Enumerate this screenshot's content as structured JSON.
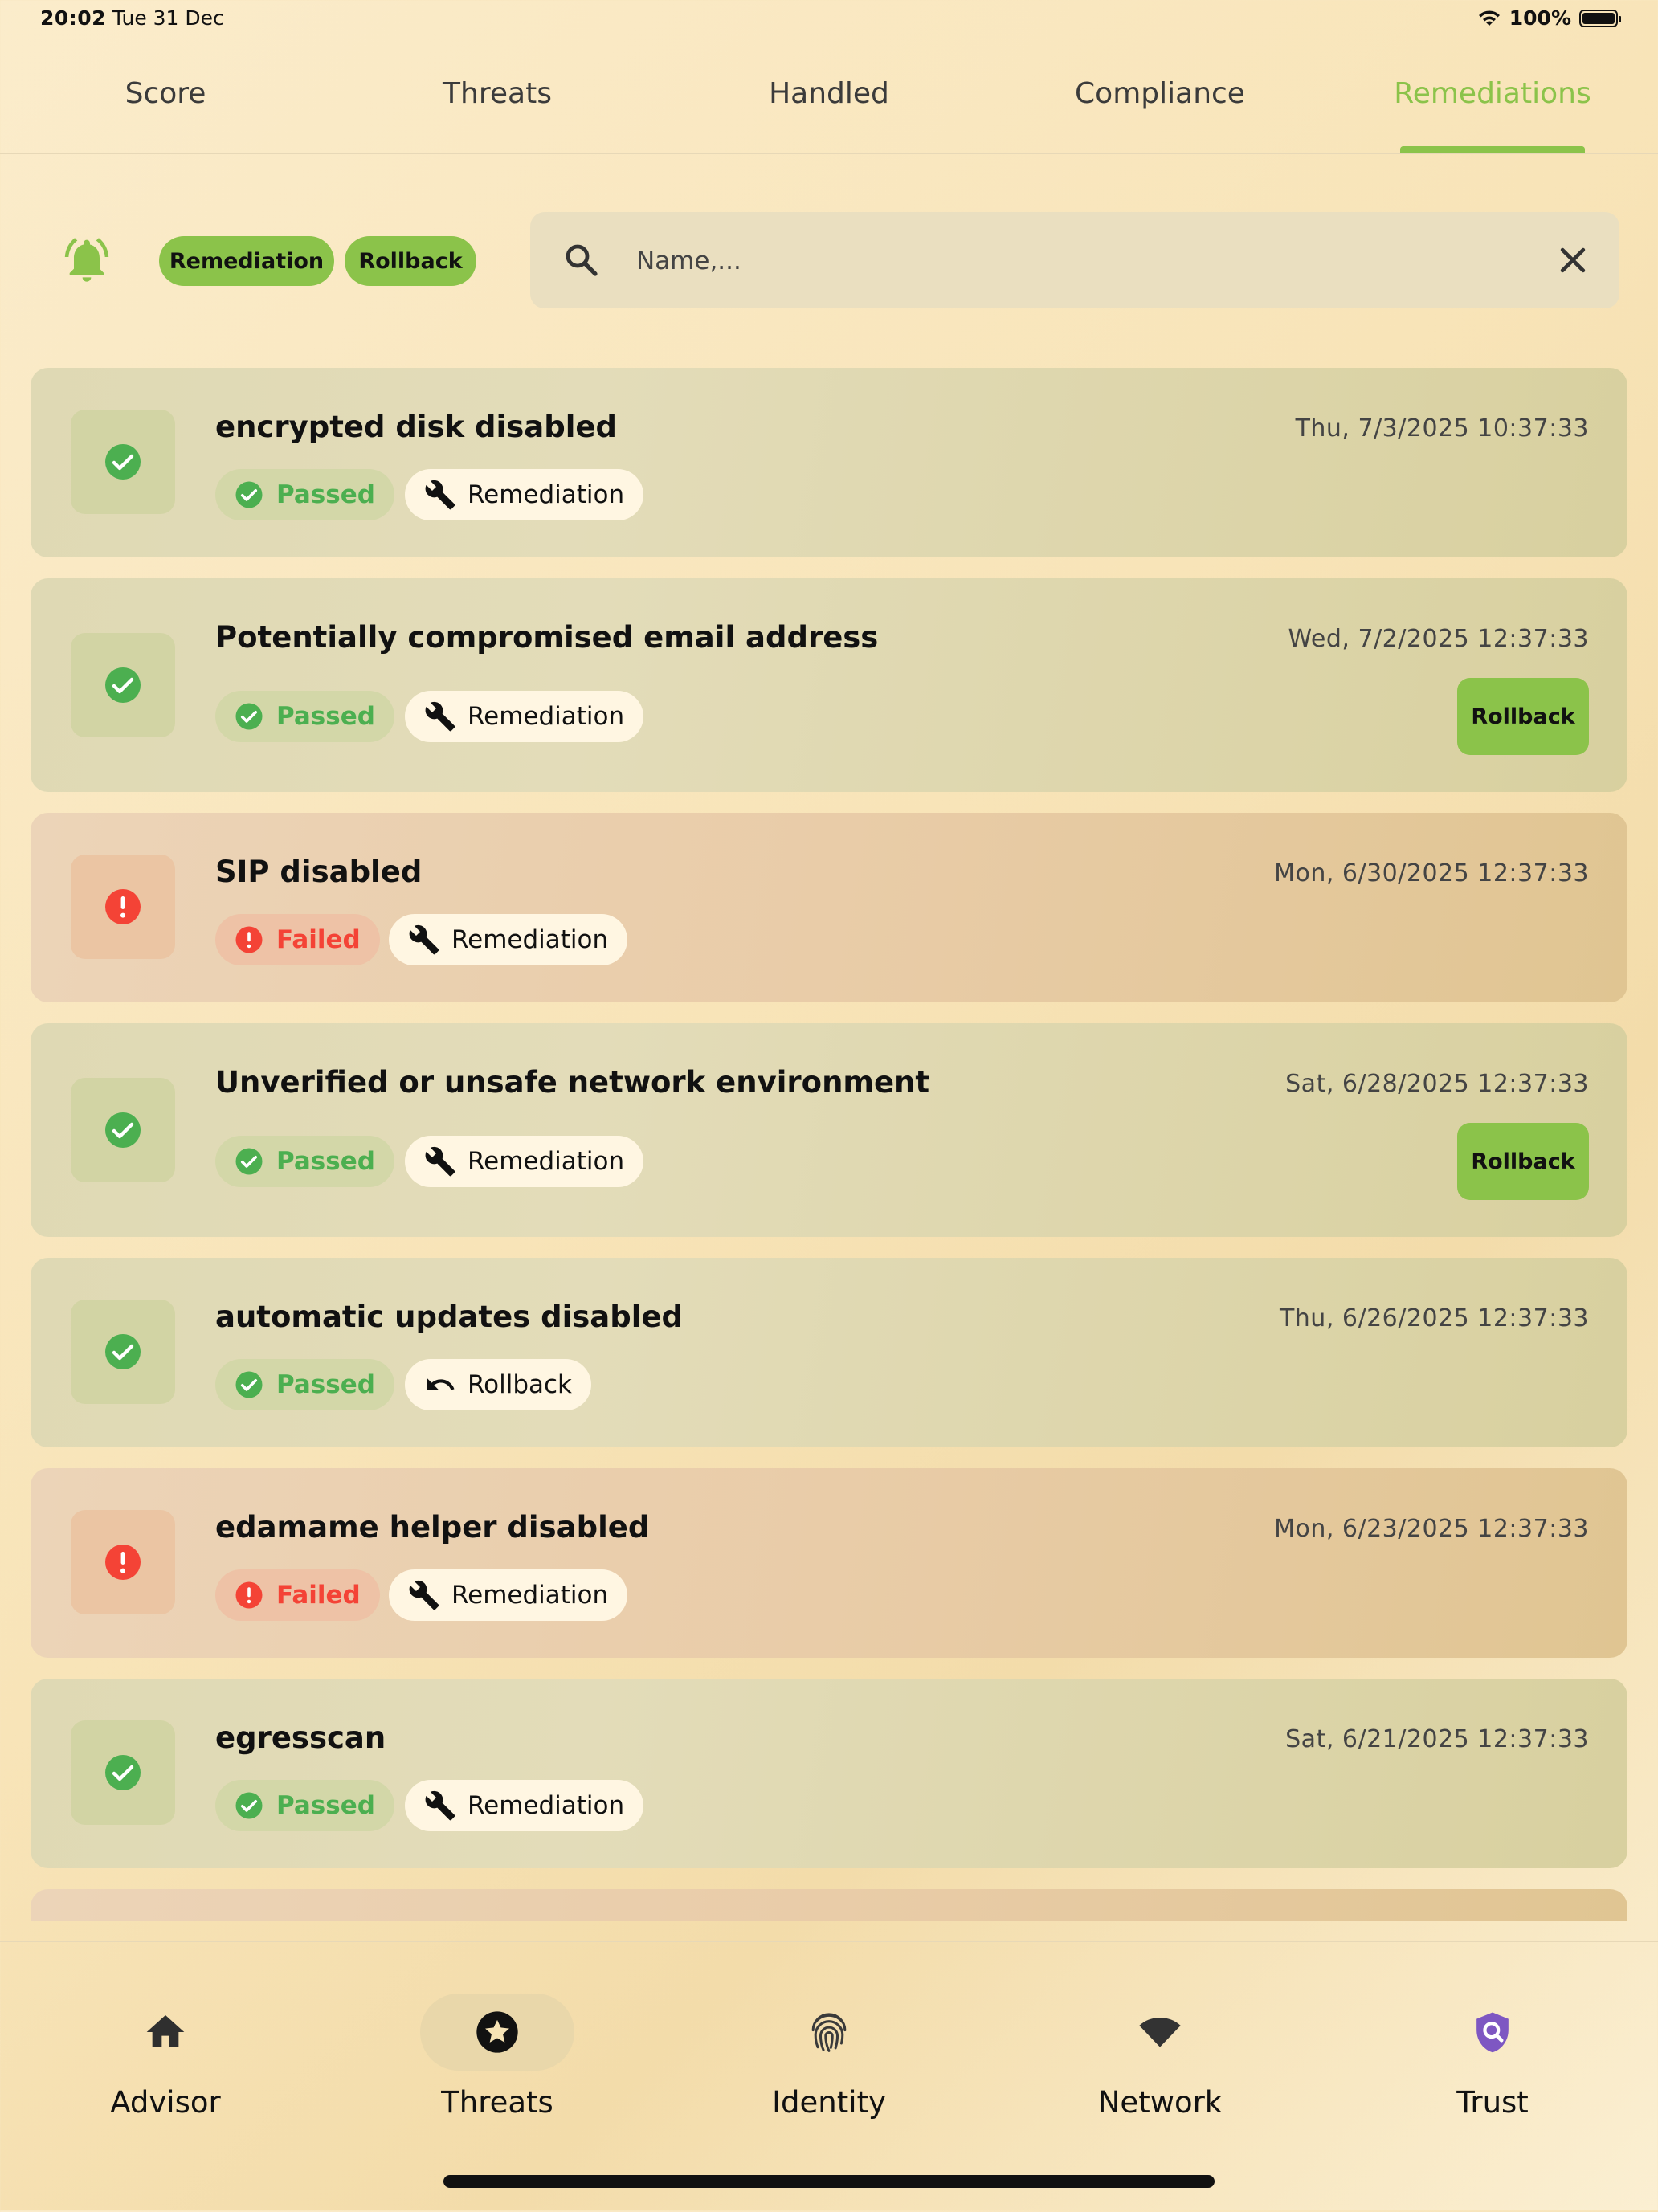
{
  "status_bar": {
    "time": "20:02",
    "date": "Tue 31 Dec",
    "battery": "100%"
  },
  "tabs": [
    {
      "label": "Score"
    },
    {
      "label": "Threats"
    },
    {
      "label": "Handled"
    },
    {
      "label": "Compliance"
    },
    {
      "label": "Remediations",
      "active": true
    }
  ],
  "filters": {
    "chip_remediation": "Remediation",
    "chip_rollback": "Rollback"
  },
  "search": {
    "placeholder": "Name,...",
    "value": ""
  },
  "items": [
    {
      "title": "encrypted disk disabled",
      "date": "Thu, 7/3/2025 10:37:33",
      "status": "Passed",
      "action": "Remediation",
      "action_icon": "wrench-icon",
      "rollback_button": null
    },
    {
      "title": "Potentially compromised email address",
      "date": "Wed, 7/2/2025 12:37:33",
      "status": "Passed",
      "action": "Remediation",
      "action_icon": "wrench-icon",
      "rollback_button": "Rollback"
    },
    {
      "title": "SIP disabled",
      "date": "Mon, 6/30/2025 12:37:33",
      "status": "Failed",
      "action": "Remediation",
      "action_icon": "wrench-icon",
      "rollback_button": null
    },
    {
      "title": "Unverified or unsafe network environment",
      "date": "Sat, 6/28/2025 12:37:33",
      "status": "Passed",
      "action": "Remediation",
      "action_icon": "wrench-icon",
      "rollback_button": "Rollback"
    },
    {
      "title": "automatic updates disabled",
      "date": "Thu, 6/26/2025 12:37:33",
      "status": "Passed",
      "action": "Rollback",
      "action_icon": "undo-icon",
      "rollback_button": null
    },
    {
      "title": "edamame helper disabled",
      "date": "Mon, 6/23/2025 12:37:33",
      "status": "Failed",
      "action": "Remediation",
      "action_icon": "wrench-icon",
      "rollback_button": null
    },
    {
      "title": "egresscan",
      "date": "Sat, 6/21/2025 12:37:33",
      "status": "Passed",
      "action": "Remediation",
      "action_icon": "wrench-icon",
      "rollback_button": null
    }
  ],
  "bottom_nav": [
    {
      "label": "Advisor",
      "icon": "home-icon"
    },
    {
      "label": "Threats",
      "icon": "star-badge-icon",
      "active": true
    },
    {
      "label": "Identity",
      "icon": "fingerprint-icon"
    },
    {
      "label": "Network",
      "icon": "wifi-icon"
    },
    {
      "label": "Trust",
      "icon": "shield-search-icon"
    }
  ],
  "colors": {
    "accent": "#8bc34a",
    "passed": "#4caf50",
    "failed": "#f44336",
    "trust_icon": "#7e57c2"
  }
}
